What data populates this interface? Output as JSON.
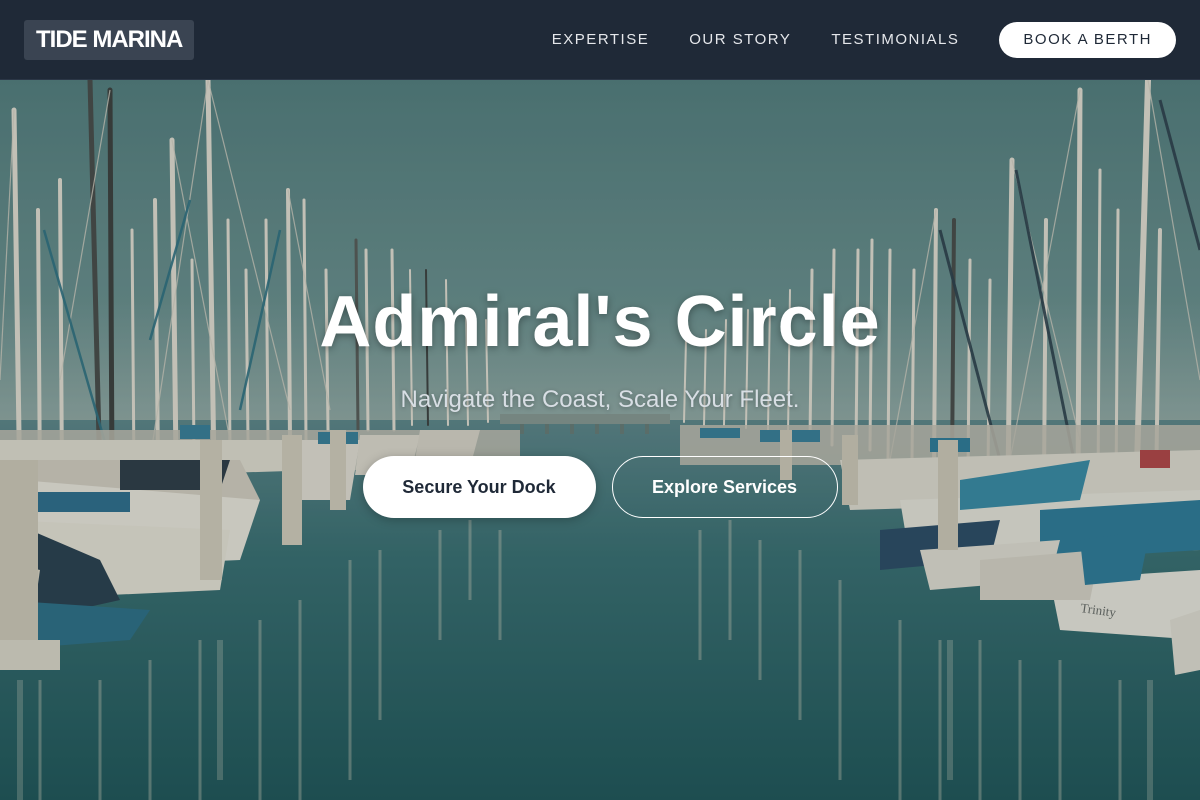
{
  "header": {
    "logo": "TIDE MARINA",
    "nav_links": [
      {
        "label": "EXPERTISE"
      },
      {
        "label": "OUR STORY"
      },
      {
        "label": "TESTIMONIALS"
      }
    ],
    "cta_label": "BOOK A BERTH"
  },
  "hero": {
    "title": "Admiral's Circle",
    "subtitle": "Navigate the Coast, Scale Your Fleet.",
    "primary_button": "Secure Your Dock",
    "secondary_button": "Explore Services",
    "background": "marina-sailboats-photo",
    "boat_name": "Trinity"
  },
  "colors": {
    "nav_bg": "#1f2937",
    "logo_bg": "#3a4452",
    "sky": "#5c8484",
    "water": "#2f6464",
    "button_text": "#1f2937"
  }
}
